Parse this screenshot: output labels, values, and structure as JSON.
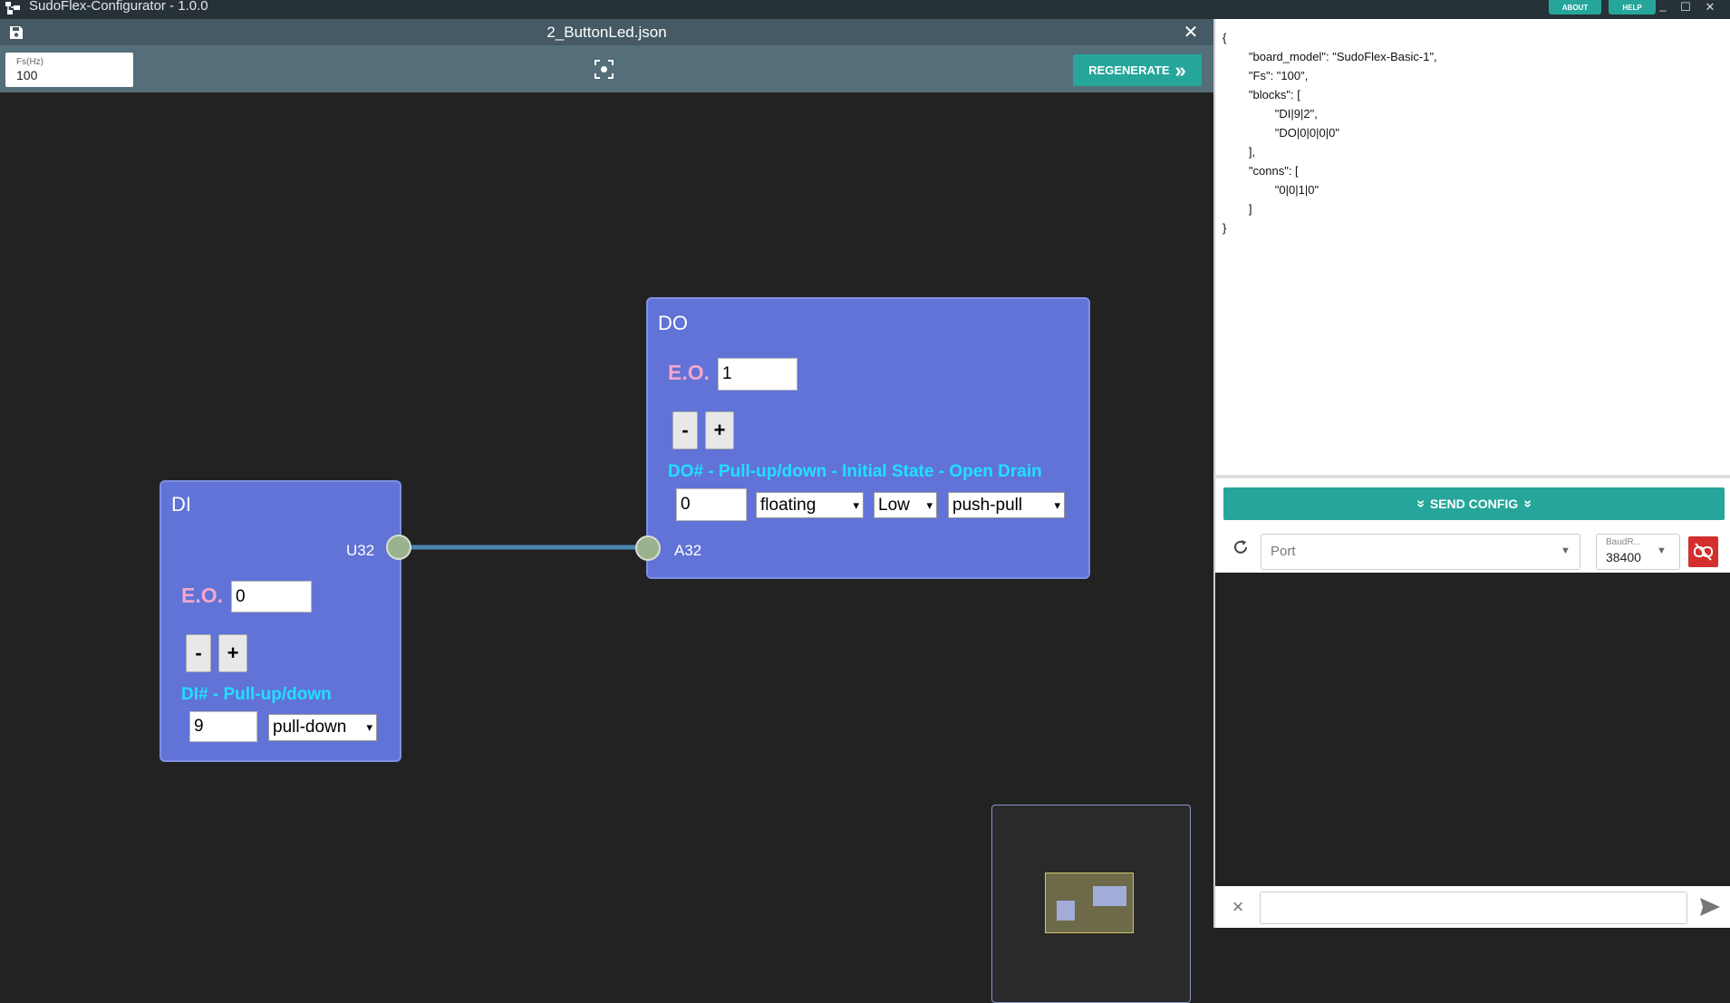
{
  "window": {
    "title": "SudoFlex-Configurator - 1.0.0",
    "about_label": "ABOUT",
    "help_label": "HELP",
    "minimize_glyph": "_",
    "maximize_glyph": "☐",
    "close_glyph": "✕"
  },
  "tab": {
    "file_name": "2_ButtonLed.json",
    "close_glyph": "✕"
  },
  "toolbar": {
    "fs_label": "Fs(Hz)",
    "fs_value": "100",
    "regenerate_label": "REGENERATE",
    "regenerate_glyph": "»"
  },
  "canvas": {
    "wire_color": "#4a86b0",
    "blocks": {
      "di": {
        "title": "DI",
        "eo_label": "E.O.",
        "eo_value": "0",
        "minus_label": "-",
        "plus_label": "+",
        "hint": "DI# - Pull-up/down",
        "pin_value": "9",
        "pull_select": "pull-down",
        "output_port": "U32"
      },
      "do": {
        "title": "DO",
        "eo_label": "E.O.",
        "eo_value": "1",
        "minus_label": "-",
        "plus_label": "+",
        "hint": "DO# - Pull-up/down - Initial State - Open Drain",
        "pin_value": "0",
        "pull_select": "floating",
        "state_select": "Low",
        "drive_select": "push-pull",
        "input_port": "A32"
      }
    }
  },
  "json_preview": "{\n        \"board_model\": \"SudoFlex-Basic-1\",\n        \"Fs\": \"100\",\n        \"blocks\": [\n                \"DI|9|2\",\n                \"DO|0|0|0|0\"\n        ],\n        \"conns\": [\n                \"0|0|1|0\"\n        ]\n}",
  "serial": {
    "send_config_label": "SEND CONFIG",
    "port_placeholder": "Port",
    "baud_label": "BaudR...",
    "baud_value": "38400"
  },
  "colors": {
    "accent": "#26a69a",
    "block": "#6173d6",
    "hint": "#20e0ff",
    "eo_label": "#f3a6cc",
    "danger": "#d32f2f"
  }
}
